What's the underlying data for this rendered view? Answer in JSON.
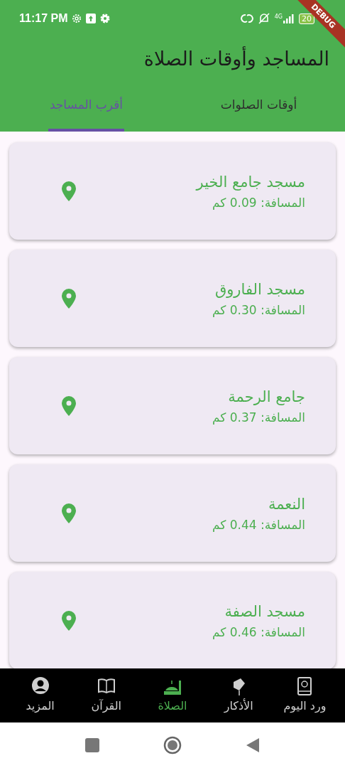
{
  "status_bar": {
    "time": "11:17 PM",
    "network": "4G",
    "battery": "20"
  },
  "debug_banner": "DEBUG",
  "app_bar": {
    "title": "المساجد وأوقات الصلاة"
  },
  "tabs": [
    {
      "label": "أوقات الصلوات",
      "selected": false
    },
    {
      "label": "أقرب المساجد",
      "selected": true
    }
  ],
  "mosques": [
    {
      "name": "مسجد جامع الخير",
      "distance": "المسافة: 0.09 كم"
    },
    {
      "name": "مسجد الفاروق",
      "distance": "المسافة: 0.30 كم"
    },
    {
      "name": "جامع الرحمة",
      "distance": "المسافة: 0.37 كم"
    },
    {
      "name": "النعمة",
      "distance": "المسافة: 0.44 كم"
    },
    {
      "name": "مسجد الصفة",
      "distance": "المسافة: 0.46 كم"
    }
  ],
  "bottom_nav": [
    {
      "label": "ورد اليوم",
      "selected": false
    },
    {
      "label": "الأذكار",
      "selected": false
    },
    {
      "label": "الصلاة",
      "selected": true
    },
    {
      "label": "القرآن",
      "selected": false
    },
    {
      "label": "المزيد",
      "selected": false
    }
  ]
}
